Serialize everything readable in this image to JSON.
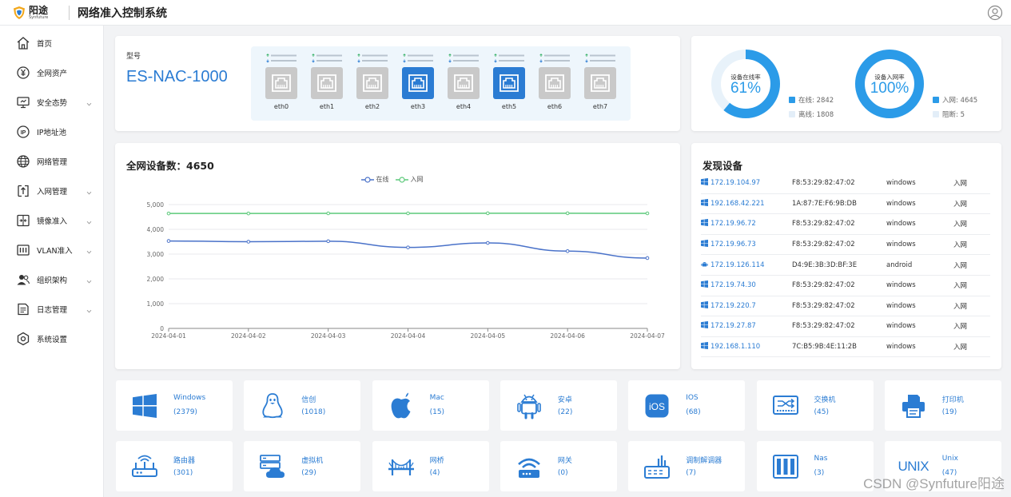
{
  "header": {
    "logo_cn": "阳途",
    "logo_en": "Synfuture",
    "title": "网络准入控制系统"
  },
  "sidebar": {
    "items": [
      {
        "label": "首页",
        "icon": "home-icon",
        "chevron": false
      },
      {
        "label": "全网资产",
        "icon": "yen-icon",
        "chevron": false
      },
      {
        "label": "安全态势",
        "icon": "monitor-icon",
        "chevron": true
      },
      {
        "label": "IP地址池",
        "icon": "ip-icon",
        "chevron": false
      },
      {
        "label": "网络管理",
        "icon": "globe-icon",
        "chevron": false
      },
      {
        "label": "入网管理",
        "icon": "login-icon",
        "chevron": true
      },
      {
        "label": "镜像准入",
        "icon": "mirror-icon",
        "chevron": true
      },
      {
        "label": "VLAN准入",
        "icon": "vlan-icon",
        "chevron": true
      },
      {
        "label": "组织架构",
        "icon": "users-icon",
        "chevron": true
      },
      {
        "label": "日志管理",
        "icon": "log-icon",
        "chevron": true
      },
      {
        "label": "系统设置",
        "icon": "settings-icon",
        "chevron": false
      }
    ]
  },
  "model": {
    "label": "型号",
    "value": "ES-NAC-1000",
    "ports": [
      {
        "name": "eth0",
        "active": false
      },
      {
        "name": "eth1",
        "active": false
      },
      {
        "name": "eth2",
        "active": false
      },
      {
        "name": "eth3",
        "active": true
      },
      {
        "name": "eth4",
        "active": false
      },
      {
        "name": "eth5",
        "active": true
      },
      {
        "name": "eth6",
        "active": false
      },
      {
        "name": "eth7",
        "active": false
      }
    ]
  },
  "rates": {
    "online": {
      "label": "设备在线率",
      "value": "61%",
      "fraction": 0.61,
      "legend": [
        "在线: 2842",
        "离线: 1808"
      ]
    },
    "access": {
      "label": "设备入网率",
      "value": "100%",
      "fraction": 1.0,
      "legend": [
        "入网: 4645",
        "阻断: 5"
      ]
    },
    "colors": {
      "primary": "#2b9be8",
      "track": "#e8f2fa"
    }
  },
  "devices_chart": {
    "title": "全网设备数：4650",
    "legend": [
      "在线",
      "入网"
    ]
  },
  "chart_data": {
    "type": "line",
    "x": [
      "2024-04-01",
      "2024-04-02",
      "2024-04-03",
      "2024-04-04",
      "2024-04-05",
      "2024-04-06",
      "2024-04-07"
    ],
    "yticks": [
      "0",
      "1,000",
      "2,000",
      "3,000",
      "4,000",
      "5,000"
    ],
    "ylim": [
      0,
      5000
    ],
    "grid": true,
    "legend_position": "top-center",
    "series": [
      {
        "name": "在线",
        "color": "#4a72c9",
        "values": [
          3530,
          3500,
          3520,
          3270,
          3450,
          3120,
          2840
        ]
      },
      {
        "name": "入网",
        "color": "#5cc97a",
        "values": [
          4640,
          4640,
          4645,
          4645,
          4648,
          4648,
          4645
        ]
      }
    ]
  },
  "discovery": {
    "title": "发现设备",
    "rows": [
      {
        "ip": "172.19.104.97",
        "mac": "F8:53:29:82:47:02",
        "os": "windows",
        "status": "入网",
        "icon": "windows-icon"
      },
      {
        "ip": "192.168.42.221",
        "mac": "1A:87:7E:F6:9B:DB",
        "os": "windows",
        "status": "入网",
        "icon": "windows-icon"
      },
      {
        "ip": "172.19.96.72",
        "mac": "F8:53:29:82:47:02",
        "os": "windows",
        "status": "入网",
        "icon": "windows-icon"
      },
      {
        "ip": "172.19.96.73",
        "mac": "F8:53:29:82:47:02",
        "os": "windows",
        "status": "入网",
        "icon": "windows-icon"
      },
      {
        "ip": "172.19.126.114",
        "mac": "D4:9E:3B:3D:BF:3E",
        "os": "android",
        "status": "入网",
        "icon": "android-icon"
      },
      {
        "ip": "172.19.74.30",
        "mac": "F8:53:29:82:47:02",
        "os": "windows",
        "status": "入网",
        "icon": "windows-icon"
      },
      {
        "ip": "172.19.220.7",
        "mac": "F8:53:29:82:47:02",
        "os": "windows",
        "status": "入网",
        "icon": "windows-icon"
      },
      {
        "ip": "172.19.27.87",
        "mac": "F8:53:29:82:47:02",
        "os": "windows",
        "status": "入网",
        "icon": "windows-icon"
      },
      {
        "ip": "192.168.1.110",
        "mac": "7C:B5:9B:4E:11:2B",
        "os": "windows",
        "status": "入网",
        "icon": "windows-icon"
      }
    ]
  },
  "device_types": [
    {
      "name": "Windows",
      "count": "(2379)",
      "icon": "windows-icon"
    },
    {
      "name": "信创",
      "count": "(1018)",
      "icon": "linux-penguin-icon"
    },
    {
      "name": "Mac",
      "count": "(15)",
      "icon": "apple-icon"
    },
    {
      "name": "安卓",
      "count": "(22)",
      "icon": "android-icon"
    },
    {
      "name": "IOS",
      "count": "(68)",
      "icon": "ios-icon"
    },
    {
      "name": "交换机",
      "count": "(45)",
      "icon": "switch-icon"
    },
    {
      "name": "打印机",
      "count": "(19)",
      "icon": "printer-icon"
    },
    {
      "name": "路由器",
      "count": "(301)",
      "icon": "router-icon"
    },
    {
      "name": "虚拟机",
      "count": "(29)",
      "icon": "vm-icon"
    },
    {
      "name": "网桥",
      "count": "(4)",
      "icon": "bridge-icon"
    },
    {
      "name": "网关",
      "count": "(0)",
      "icon": "gateway-icon"
    },
    {
      "name": "调制解调器",
      "count": "(7)",
      "icon": "modem-icon"
    },
    {
      "name": "Nas",
      "count": "(3)",
      "icon": "nas-icon"
    },
    {
      "name": "Unix",
      "count": "(47)",
      "icon": "unix-icon",
      "icon_text": "UNIX"
    }
  ],
  "watermark": "CSDN @Synfuture阳途"
}
